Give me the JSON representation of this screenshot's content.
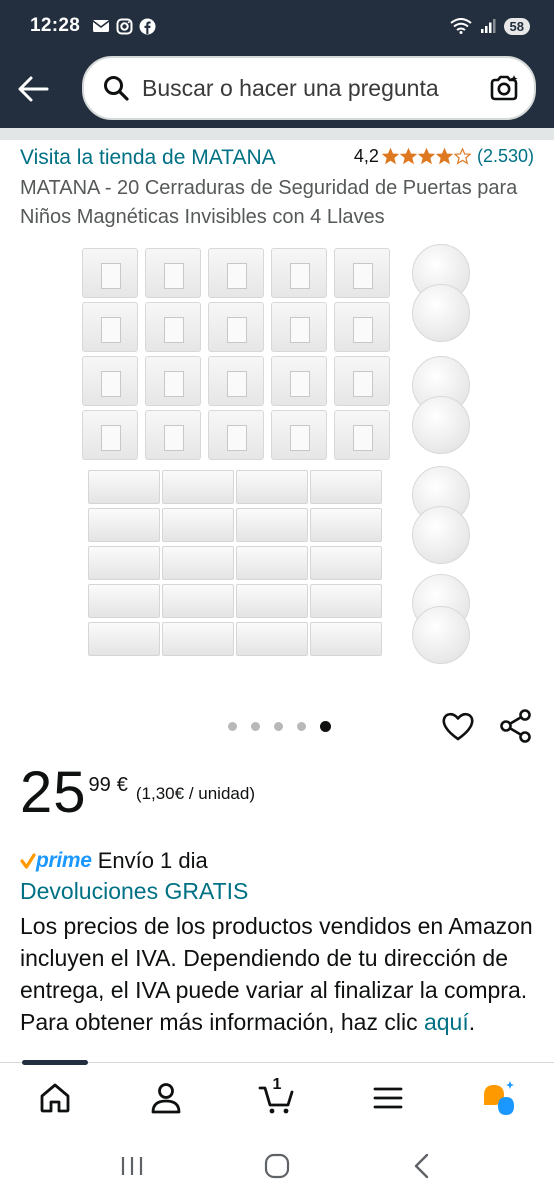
{
  "status_bar": {
    "time": "12:28",
    "battery": "58",
    "left_icons": [
      "mail-icon",
      "instagram-icon",
      "facebook-icon"
    ],
    "right_icons": [
      "wifi-icon",
      "signal-icon",
      "battery-icon"
    ]
  },
  "header": {
    "search_placeholder": "Buscar o hacer una pregunta",
    "icons": [
      "back-arrow-icon",
      "search-icon",
      "camera-search-icon"
    ]
  },
  "product": {
    "store_link": "Visita la tienda de MATANA",
    "rating_value": "4,2",
    "rating_stars": 4.2,
    "rating_count": "(2.530)",
    "title": "MATANA - 20 Cerraduras de Seguridad de Puertas para Niños Magnéticas Invisibles con 4 Llaves"
  },
  "gallery": {
    "image_count": 5,
    "active_index": 4
  },
  "price": {
    "whole": "25",
    "fraction": "99",
    "currency": "€",
    "unit_price": "(1,30€ / unidad)"
  },
  "delivery": {
    "prime_label": "prime",
    "delivery_text": "Envío 1 dia",
    "returns": "Devoluciones GRATIS",
    "tax_text": "Los precios de los productos vendidos en Amazon incluyen el IVA. Dependiendo de tu dirección de entrega, el IVA puede variar al finalizar la compra. Para obtener más información, haz clic ",
    "tax_link": "aquí",
    "tax_end": "."
  },
  "bottom_nav": {
    "cart_count": "1",
    "items": [
      "home-icon",
      "account-icon",
      "cart-icon",
      "menu-icon",
      "rufus-ai-icon"
    ]
  },
  "colors": {
    "header_bg": "#232f3e",
    "link": "#007185",
    "star": "#de7921",
    "prime": "#1a98ff"
  }
}
